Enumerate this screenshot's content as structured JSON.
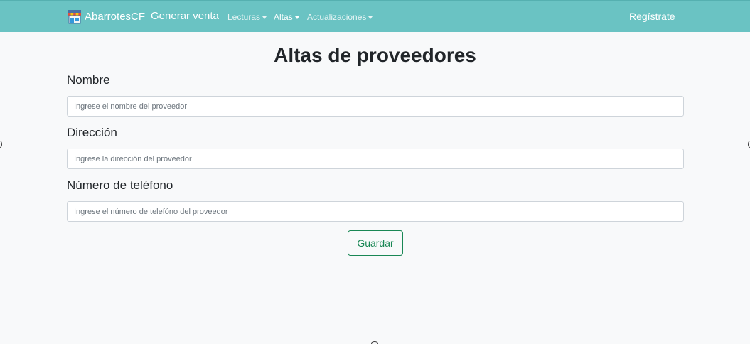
{
  "navbar": {
    "brand_name": "AbarrotesCF",
    "brand_icon": "store-icon",
    "main_link": "Generar venta",
    "dropdowns": [
      {
        "label": "Lecturas"
      },
      {
        "label": "Altas"
      },
      {
        "label": "Actualizaciones"
      }
    ],
    "register_link": "Regístrate"
  },
  "page": {
    "title": "Altas de proveedores"
  },
  "form": {
    "name_label": "Nombre",
    "name_placeholder": "Ingrese el nombre del proveedor",
    "address_label": "Dirección",
    "address_placeholder": "Ingrese la dirección del proveedor",
    "phone_label": "Número de teléfono",
    "phone_placeholder": "Ingrese el número de telefóno del proveedor",
    "save_label": "Guardar"
  },
  "colors": {
    "navbar": "#6ac3c3",
    "success": "#198754",
    "background": "#f8f9fa"
  }
}
